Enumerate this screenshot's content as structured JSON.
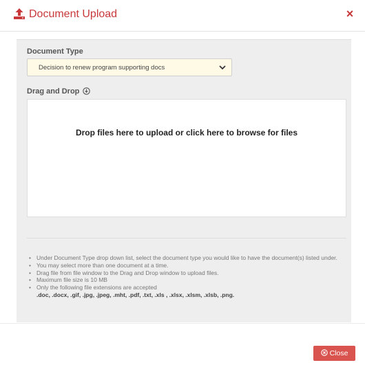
{
  "modal": {
    "title": "Document Upload",
    "close_symbol": "×",
    "header_icon": "upload-icon",
    "accent_color": "#c8383b"
  },
  "form": {
    "document_type_label": "Document Type",
    "document_type_selected": "Decision to renew program supporting docs",
    "drag_drop_label": "Drag and Drop",
    "dropzone_text": "Drop files here to upload or click here to browse for files"
  },
  "notes": {
    "items": [
      "Under Document Type drop down list, select the document type you would like to have the document(s) listed under.",
      "You may select more than one document at a time.",
      "Drag file from file window to the Drag and Drop window to upload files.",
      "Maximum file size is 10 MB",
      "Only the following file extensions are accepted"
    ],
    "extensions": ".doc, .docx, .gif, .jpg, .jpeg, .mht, .pdf, .txt, .xls , .xlsx, .xlsm, .xlsb, .png."
  },
  "footer": {
    "close_label": "Close",
    "close_color": "#d9534f"
  }
}
